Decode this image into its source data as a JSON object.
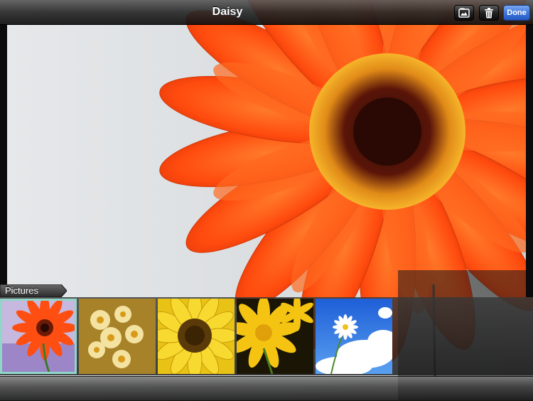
{
  "navbar": {
    "title": "Daisy",
    "done_label": "Done"
  },
  "icons": {
    "album": "photo-album-icon",
    "trash": "trash-icon"
  },
  "strip": {
    "tab_label": "Pictures",
    "thumbnails": [
      {
        "subject": "orange gerbera",
        "selected": true
      },
      {
        "subject": "yellow daisies bouquet",
        "selected": false
      },
      {
        "subject": "yellow sunflower",
        "selected": false
      },
      {
        "subject": "yellow flower on dark",
        "selected": false
      },
      {
        "subject": "white daisy blue sky",
        "selected": false
      }
    ]
  },
  "colors": {
    "accent_done": "#3f78d9",
    "selected_border": "#8fd6c8",
    "petal": "#ff5a14"
  }
}
